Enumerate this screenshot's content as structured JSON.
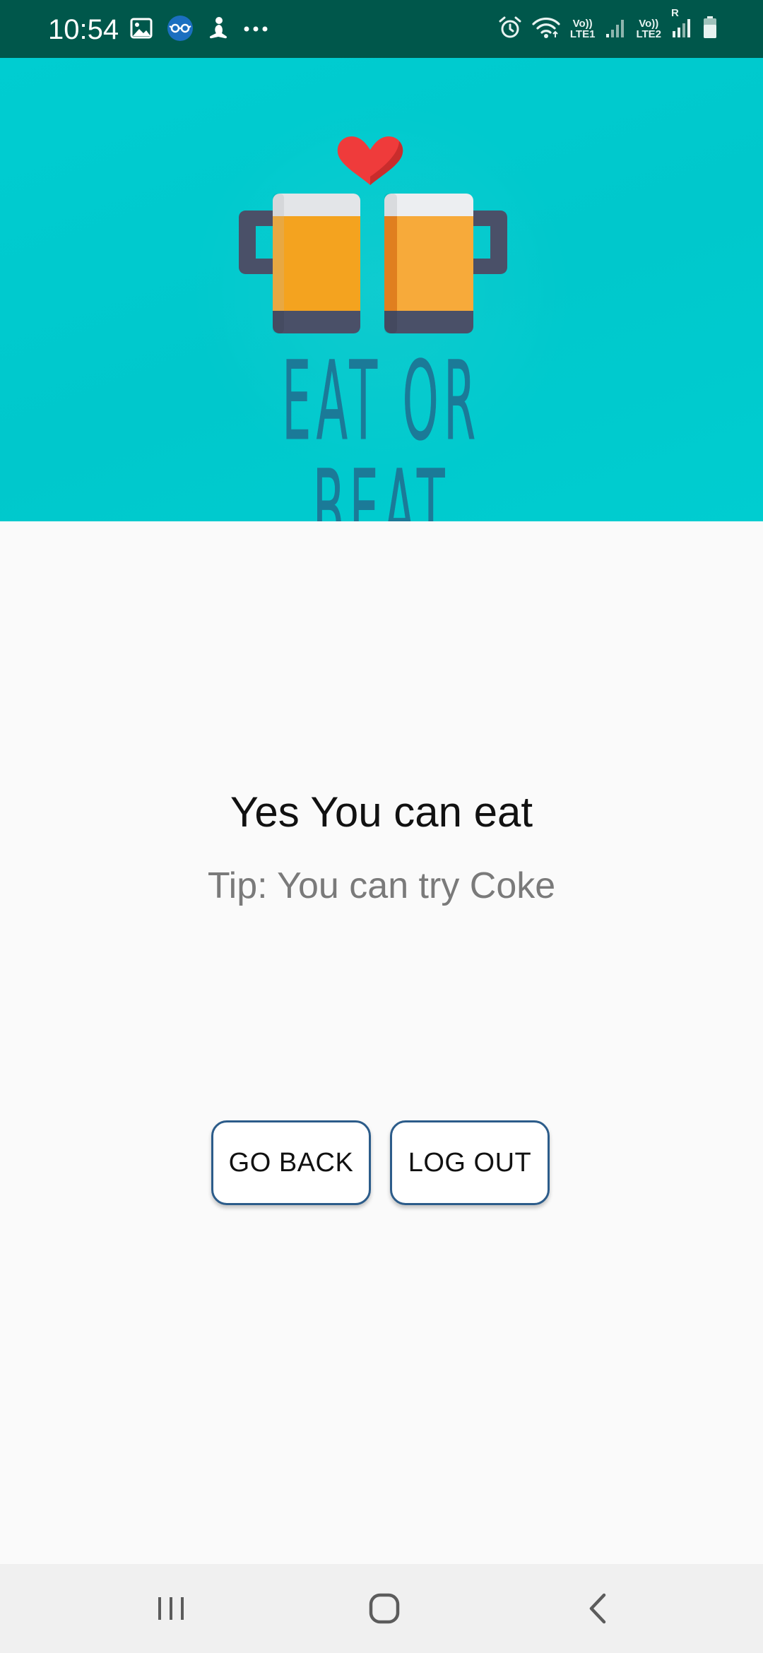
{
  "status_bar": {
    "time": "10:54",
    "left_icons": [
      "gallery-icon",
      "glasses-app-icon",
      "meditation-icon",
      "more-dots-icon"
    ],
    "right_icons": [
      "alarm-icon",
      "wifi-icon",
      "signal-sim1-icon",
      "signal-sim2-icon",
      "battery-icon"
    ],
    "sim1_top": "Vo))",
    "sim1_bottom": "LTE1",
    "sim2_top": "Vo))",
    "sim2_bottom": "LTE2",
    "roaming": "R",
    "background_color": "#00574b"
  },
  "header": {
    "background_color": "#00c8cc",
    "logo_text": "EAT OR BEAT",
    "logo_icons": [
      "heart-icon",
      "beer-mug-left-icon",
      "beer-mug-right-icon"
    ]
  },
  "result": {
    "title": "Yes You can eat",
    "tip": "Tip: You can try Coke"
  },
  "buttons": {
    "go_back": "GO BACK",
    "log_out": "LOG OUT"
  },
  "nav_bar": {
    "icons": [
      "recents-icon",
      "home-icon",
      "back-icon"
    ]
  }
}
